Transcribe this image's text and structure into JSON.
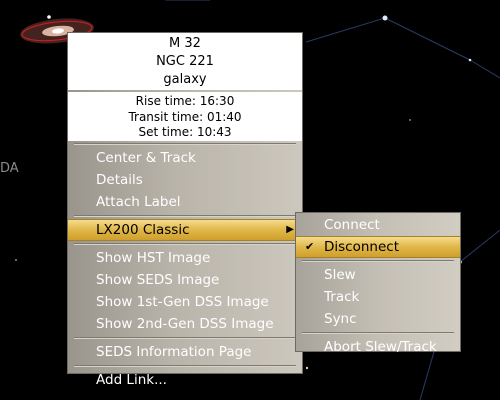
{
  "sky": {
    "label": "DA"
  },
  "object": {
    "name": "M 32",
    "catalog_id": "NGC 221",
    "type": "galaxy",
    "rise_time": "Rise time: 16:30",
    "transit_time": "Transit time: 01:40",
    "set_time": "Set time: 10:43"
  },
  "menu": {
    "items": [
      {
        "label": "Center & Track"
      },
      {
        "label": "Details"
      },
      {
        "label": "Attach Label"
      },
      {
        "label": "LX200 Classic",
        "submenu_arrow": "▶"
      },
      {
        "label": "Show HST Image"
      },
      {
        "label": "Show SEDS Image"
      },
      {
        "label": "Show 1st-Gen DSS Image"
      },
      {
        "label": "Show 2nd-Gen DSS Image"
      },
      {
        "label": "SEDS Information Page"
      },
      {
        "label": "Add Link..."
      }
    ]
  },
  "submenu": {
    "items": [
      {
        "label": "Connect"
      },
      {
        "label": "Disconnect",
        "checked": true,
        "check_mark": "✔"
      },
      {
        "label": "Slew"
      },
      {
        "label": "Track"
      },
      {
        "label": "Sync"
      },
      {
        "label": "Abort Slew/Track"
      }
    ]
  },
  "colors": {
    "highlight": "#e0b748",
    "menu_text": "#ffffff",
    "sky": "#000000"
  }
}
